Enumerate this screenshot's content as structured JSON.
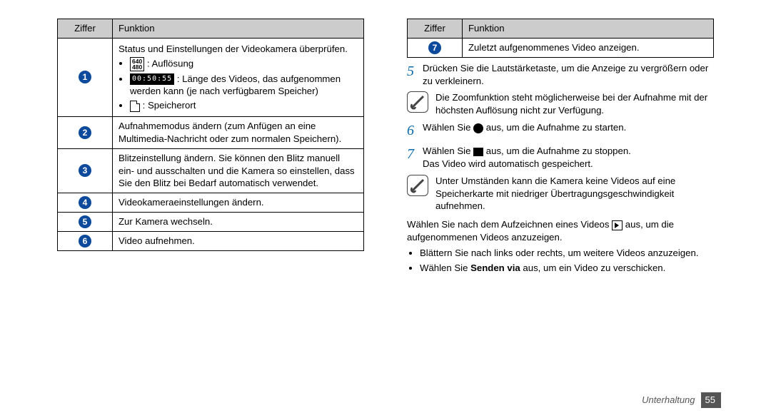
{
  "headers": {
    "num": "Ziffer",
    "func": "Funktion"
  },
  "num_glyphs": [
    "1",
    "2",
    "3",
    "4",
    "5",
    "6",
    "7"
  ],
  "left_rows": [
    {
      "intro": "Status und Einstellungen der Videokamera überprüfen.",
      "bullets": [
        {
          "icon": "res",
          "icon_text": "640\n480",
          "text": ": Auflösung"
        },
        {
          "icon": "time",
          "icon_text": "00:50:55",
          "text": ": Länge des Videos, das aufgenommen werden kann (je nach verfügbarem Speicher)"
        },
        {
          "icon": "sd",
          "text": ": Speicherort"
        }
      ]
    },
    {
      "text": "Aufnahmemodus ändern (zum Anfügen an eine Multimedia-Nachricht oder zum normalen Speichern)."
    },
    {
      "text": "Blitzeinstellung ändern. Sie können den Blitz manuell ein- und ausschalten und die Kamera so einstellen, dass Sie den Blitz bei Bedarf automatisch verwendet."
    },
    {
      "text": "Videokameraeinstellungen ändern."
    },
    {
      "text": "Zur Kamera wechseln."
    },
    {
      "text": "Video aufnehmen."
    }
  ],
  "right_row7": "Zuletzt aufgenommenes Video anzeigen.",
  "step5": "Drücken Sie die Lautstärketaste, um die Anzeige zu vergrößern oder zu verkleinern.",
  "note1": "Die Zoomfunktion steht möglicherweise bei der Aufnahme mit der höchsten Auflösung nicht zur Verfügung.",
  "step6_a": "Wählen Sie ",
  "step6_b": " aus, um die Aufnahme zu starten.",
  "step7_a": "Wählen Sie ",
  "step7_b": " aus, um die Aufnahme zu stoppen.",
  "step7_c": "Das Video wird automatisch gespeichert.",
  "note2": "Unter Umständen kann die Kamera keine Videos auf eine Speicherkarte mit niedriger Übertragungsgeschwindigkeit aufnehmen.",
  "post_a": "Wählen Sie nach dem Aufzeichnen eines Videos ",
  "post_b": " aus, um die aufgenommenen Videos anzuzeigen.",
  "bullet1": "Blättern Sie nach links oder rechts, um weitere Videos anzuzeigen.",
  "bullet2_a": "Wählen Sie ",
  "bullet2_bold": "Senden via",
  "bullet2_b": " aus, um ein Video zu verschicken.",
  "footer": {
    "cat": "Unterhaltung",
    "pg": "55"
  }
}
